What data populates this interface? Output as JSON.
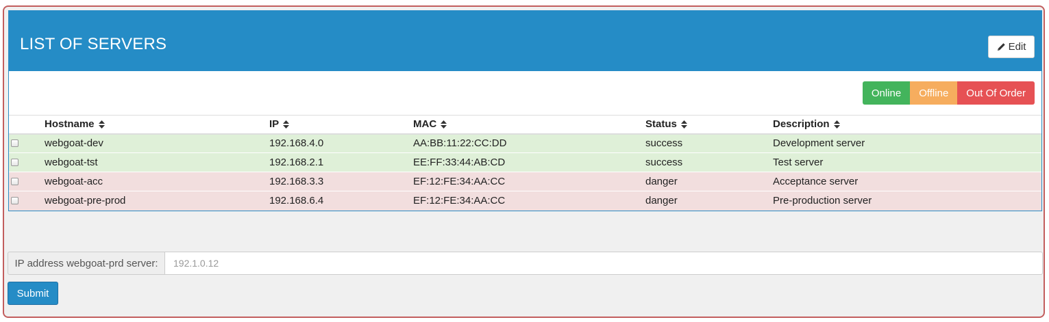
{
  "panel": {
    "title": "LIST OF SERVERS",
    "edit_label": "Edit"
  },
  "status_buttons": {
    "online": "Online",
    "offline": "Offline",
    "out_of_order": "Out Of Order"
  },
  "table": {
    "columns": [
      "Hostname",
      "IP",
      "MAC",
      "Status",
      "Description"
    ],
    "rows": [
      {
        "hostname": "webgoat-dev",
        "ip": "192.168.4.0",
        "mac": "AA:BB:11:22:CC:DD",
        "status": "success",
        "description": "Development server"
      },
      {
        "hostname": "webgoat-tst",
        "ip": "192.168.2.1",
        "mac": "EE:FF:33:44:AB:CD",
        "status": "success",
        "description": "Test server"
      },
      {
        "hostname": "webgoat-acc",
        "ip": "192.168.3.3",
        "mac": "EF:12:FE:34:AA:CC",
        "status": "danger",
        "description": "Acceptance server"
      },
      {
        "hostname": "webgoat-pre-prod",
        "ip": "192.168.6.4",
        "mac": "EF:12:FE:34:AA:CC",
        "status": "danger",
        "description": "Pre-production server"
      }
    ]
  },
  "form": {
    "ip_label": "IP address webgoat-prd server:",
    "ip_placeholder": "192.1.0.12",
    "submit_label": "Submit"
  },
  "colors": {
    "header": "#258cc6",
    "online": "#43b45c",
    "offline": "#f6ad5e",
    "out_of_order": "#e65154",
    "row_success": "#dff0d8",
    "row_danger": "#f2dede"
  },
  "icons": {
    "edit": "pencil-icon",
    "sort": "sort-icon",
    "checkbox": "checkbox"
  }
}
